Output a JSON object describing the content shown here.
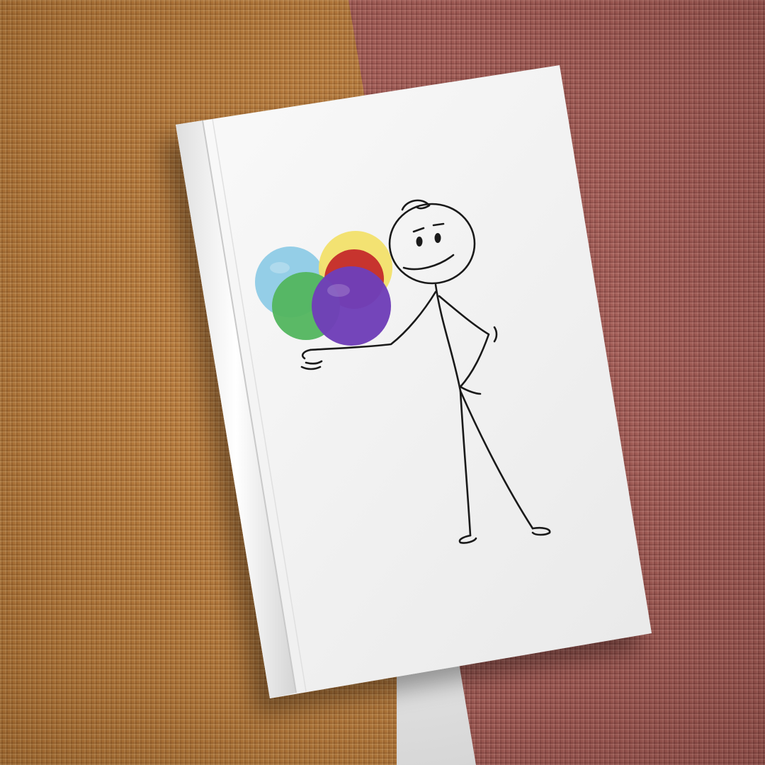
{
  "scene": {
    "left_fabric_color": "#c6823c",
    "right_fabric_color": "#b0615a",
    "book_color": "#f4f4f4"
  },
  "balloons": [
    {
      "color": "#8ecbe6"
    },
    {
      "color": "#f2e06a"
    },
    {
      "color": "#c42a2a"
    },
    {
      "color": "#52b55e"
    },
    {
      "color": "#6f3fb8"
    }
  ],
  "illustration": {
    "icons": [
      "stick-figure-icon",
      "balloon-bunch-icon"
    ]
  }
}
